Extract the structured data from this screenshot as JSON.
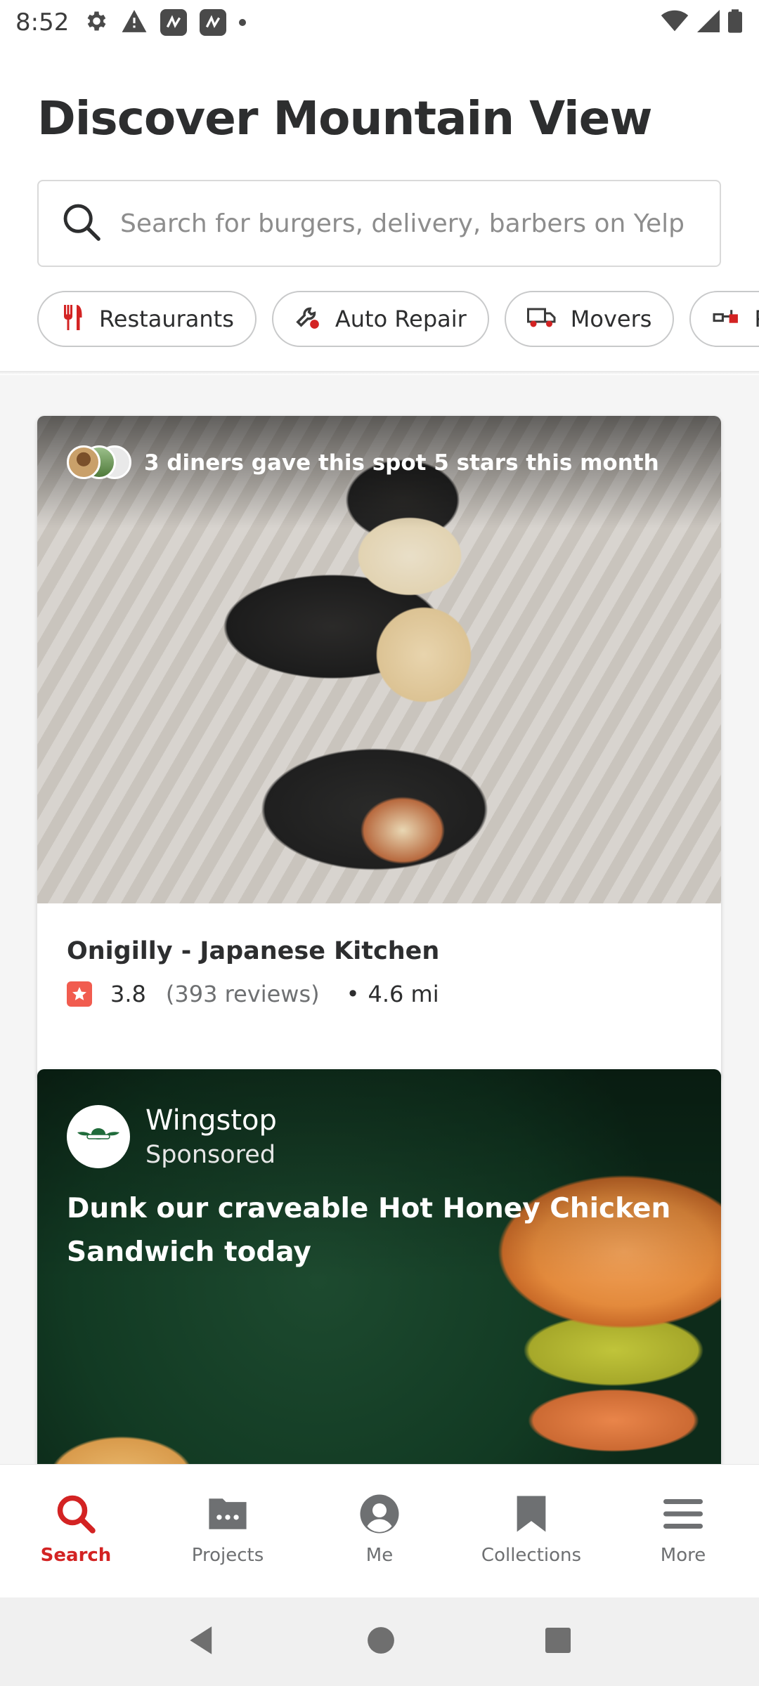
{
  "status_bar": {
    "time": "8:52",
    "left_icons": [
      "gear-icon",
      "warning-icon",
      "app-icon",
      "app-icon",
      "dot-icon"
    ],
    "right_icons": [
      "wifi-icon",
      "signal-icon",
      "battery-icon"
    ]
  },
  "header": {
    "title": "Discover Mountain View"
  },
  "search": {
    "placeholder": "Search for burgers, delivery, barbers on Yelp"
  },
  "categories": [
    {
      "label": "Restaurants",
      "icon": "utensils-icon"
    },
    {
      "label": "Auto Repair",
      "icon": "wrench-icon"
    },
    {
      "label": "Movers",
      "icon": "truck-icon"
    },
    {
      "label": "P",
      "icon": "plumbing-icon"
    }
  ],
  "feed": {
    "card1": {
      "social_proof": "3 diners gave this spot 5 stars this month",
      "name": "Onigilly - Japanese Kitchen",
      "rating": "3.8",
      "reviews": "(393 reviews)",
      "distance": "4.6 mi"
    },
    "ad": {
      "brand": "Wingstop",
      "sponsored": "Sponsored",
      "headline": "Dunk our craveable Hot Honey Chicken Sandwich today"
    }
  },
  "bottom_nav": [
    {
      "label": "Search",
      "icon": "search-icon",
      "active": true
    },
    {
      "label": "Projects",
      "icon": "projects-icon",
      "active": false
    },
    {
      "label": "Me",
      "icon": "profile-icon",
      "active": false
    },
    {
      "label": "Collections",
      "icon": "bookmark-icon",
      "active": false
    },
    {
      "label": "More",
      "icon": "menu-icon",
      "active": false
    }
  ],
  "colors": {
    "brand_red": "#d32323",
    "star_red": "#f15c4f",
    "text_dark": "#2d2e2f",
    "text_muted": "#6e7072"
  }
}
